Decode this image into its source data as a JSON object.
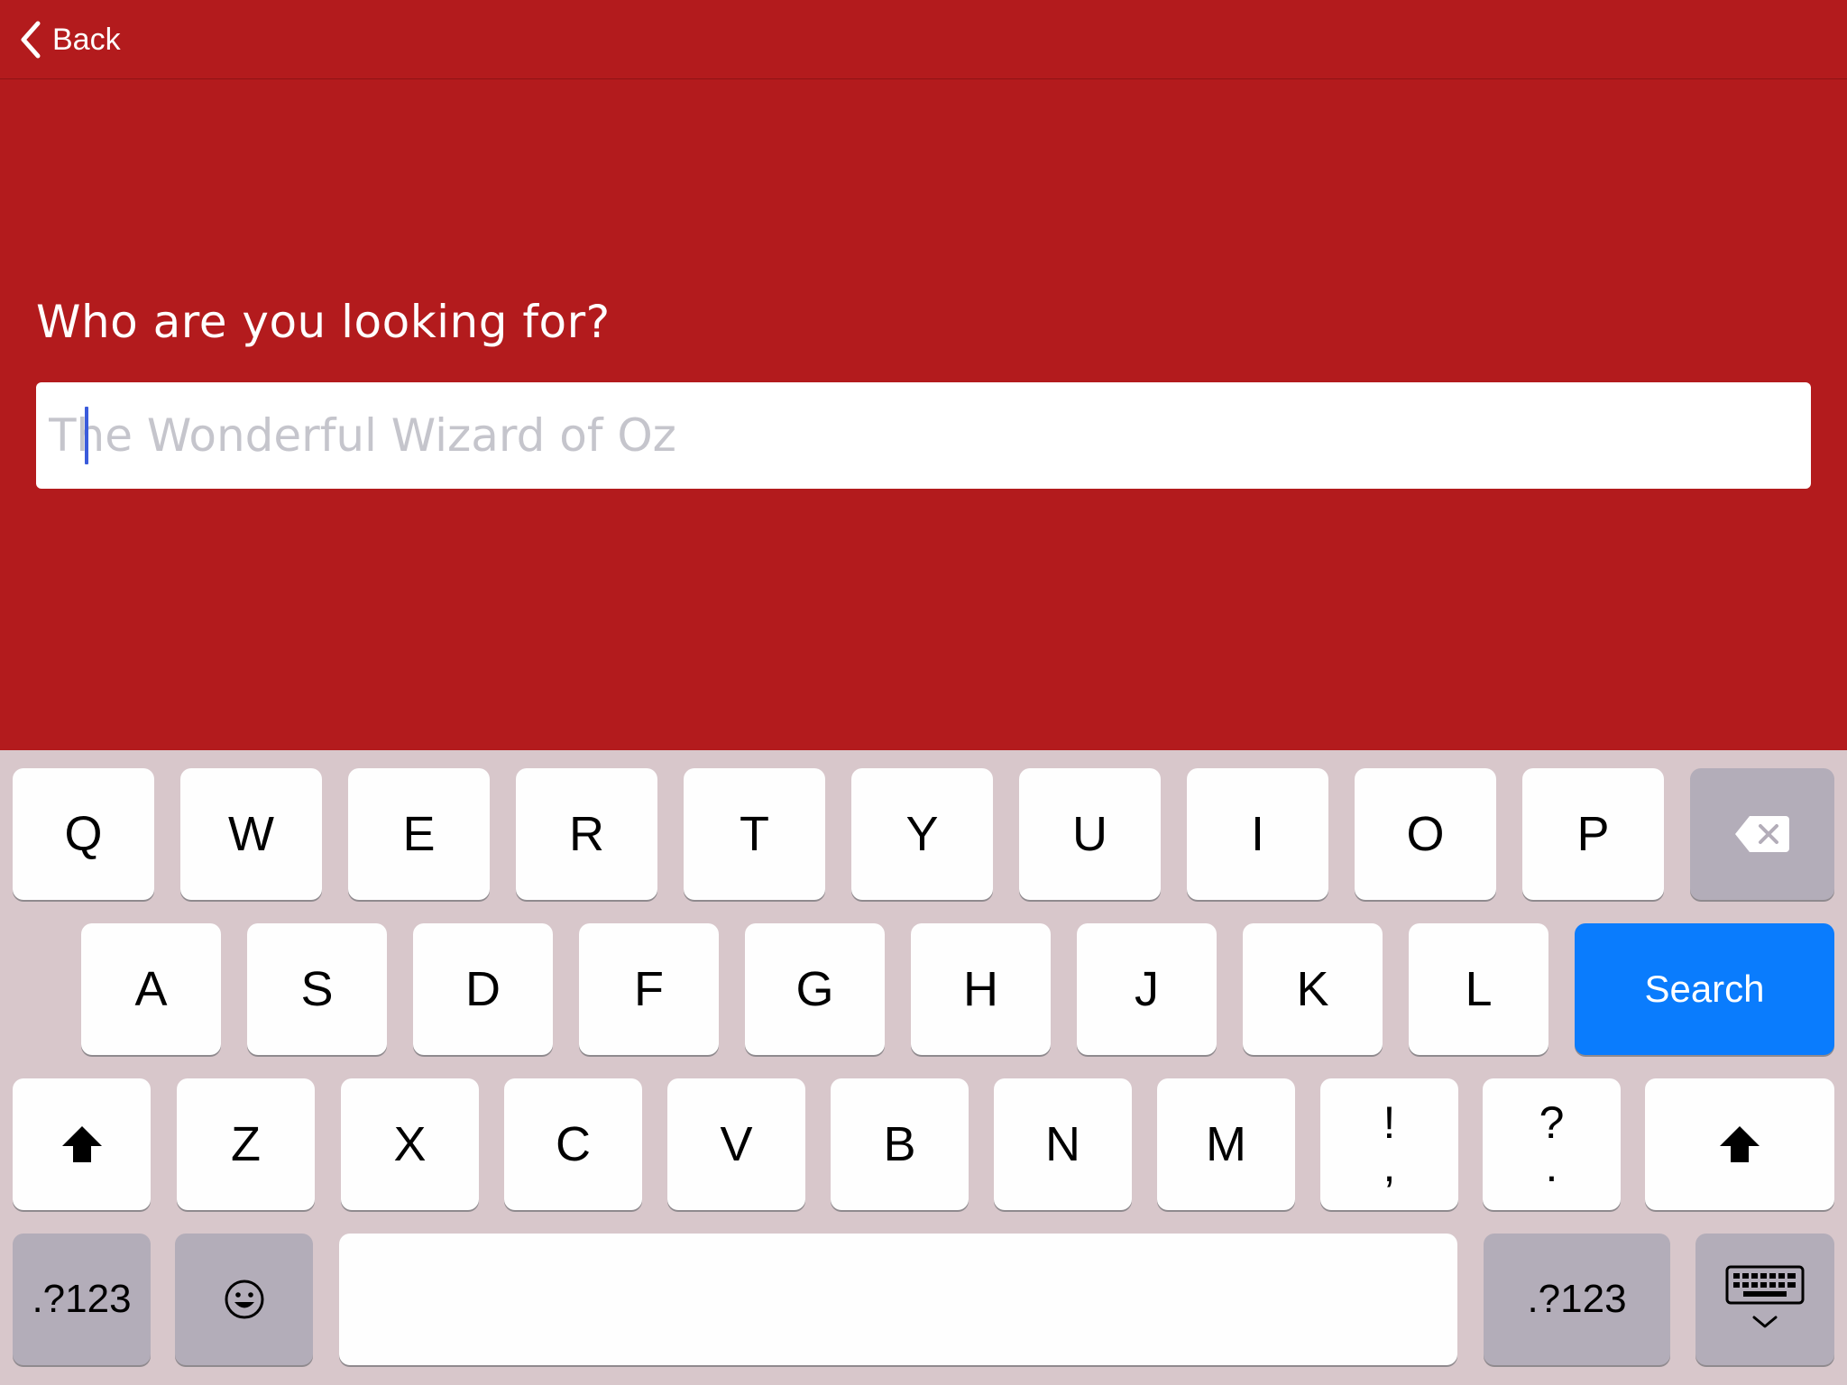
{
  "nav": {
    "back_label": "Back"
  },
  "prompt": {
    "question": "Who are you looking for?"
  },
  "search": {
    "value": "",
    "placeholder": "The Wonderful Wizard of Oz"
  },
  "colors": {
    "background": "#b31b1d",
    "keyboard": "#d8c7cb",
    "search_key": "#0a7cfd",
    "caret": "#3b5bdb"
  },
  "keyboard": {
    "row1": [
      "Q",
      "W",
      "E",
      "R",
      "T",
      "Y",
      "U",
      "I",
      "O",
      "P"
    ],
    "row2": [
      "A",
      "S",
      "D",
      "F",
      "G",
      "H",
      "J",
      "K",
      "L"
    ],
    "row3": [
      "Z",
      "X",
      "C",
      "V",
      "B",
      "N",
      "M"
    ],
    "punct1": {
      "top": "!",
      "bottom": ","
    },
    "punct2": {
      "top": "?",
      "bottom": "."
    },
    "search_label": "Search",
    "numbers_label": ".?123",
    "icons": {
      "backspace": "backspace-icon",
      "shift": "shift-icon",
      "emoji": "emoji-icon",
      "dismiss": "keyboard-dismiss-icon"
    }
  }
}
